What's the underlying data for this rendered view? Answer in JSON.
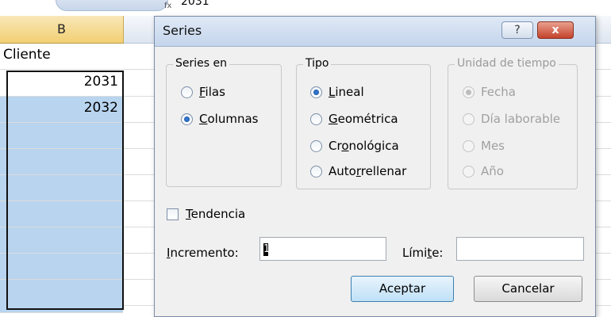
{
  "sheet": {
    "formula_value": "2031",
    "column_header": "B",
    "header_cell": "Cliente",
    "cells": [
      "2031",
      "2032"
    ]
  },
  "dialog": {
    "title": "Series",
    "help_label": "?",
    "close_label": "x",
    "series_en": {
      "legend": "Series en",
      "options": [
        {
          "pre": "",
          "key": "F",
          "post": "ilas",
          "selected": false
        },
        {
          "pre": "",
          "key": "C",
          "post": "olumnas",
          "selected": true
        }
      ]
    },
    "tipo": {
      "legend": "Tipo",
      "options": [
        {
          "pre": "",
          "key": "L",
          "post": "ineal",
          "selected": true
        },
        {
          "pre": "",
          "key": "G",
          "post": "eométrica",
          "selected": false
        },
        {
          "pre": "Cr",
          "key": "o",
          "post": "nológica",
          "selected": false
        },
        {
          "pre": "Auto",
          "key": "r",
          "post": "rellenar",
          "selected": false
        }
      ]
    },
    "unidad": {
      "legend": "Unidad de tiempo",
      "disabled": true,
      "options": [
        {
          "label": "Fecha",
          "selected": true
        },
        {
          "label": "Día laborable",
          "selected": false
        },
        {
          "label": "Mes",
          "selected": false
        },
        {
          "label": "Año",
          "selected": false
        }
      ]
    },
    "tendencia": {
      "key": "T",
      "rest": "endencia",
      "checked": false
    },
    "incremento": {
      "key": "I",
      "rest": "ncremento:",
      "value": "1"
    },
    "limite": {
      "pre": "Lími",
      "key": "t",
      "post": "e:",
      "value": ""
    },
    "accept_label": "Aceptar",
    "cancel_label": "Cancelar"
  }
}
